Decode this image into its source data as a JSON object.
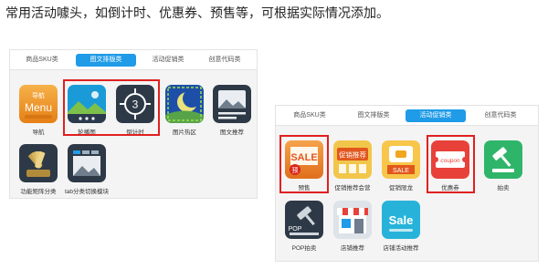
{
  "heading": "常用活动噱头，如倒计时、优惠券、预售等，可根据实际情况添加。",
  "left_panel": {
    "tabs": [
      "商品SKU类",
      "图文排版类",
      "活动促销类",
      "创意代码类"
    ],
    "active_tab": "图文排版类",
    "tiles": [
      {
        "label": "导航",
        "icon": "menu-icon",
        "icon_text": [
          "导航",
          "Menu"
        ]
      },
      {
        "label": "轮播图",
        "icon": "carousel-icon"
      },
      {
        "label": "倒计时",
        "icon": "countdown-icon",
        "icon_text": "3"
      },
      {
        "label": "图片热区",
        "icon": "hotspot-icon"
      },
      {
        "label": "图文推荐",
        "icon": "image-text-icon"
      },
      {
        "label": "功能矩阵分类",
        "icon": "matrix-icon"
      },
      {
        "label": "tab分类切换模块",
        "icon": "tab-switch-icon"
      }
    ]
  },
  "right_panel": {
    "tabs": [
      "商品SKU类",
      "图文排版类",
      "活动促销类",
      "创意代码类"
    ],
    "active_tab": "活动促销类",
    "tiles": [
      {
        "label": "预售",
        "icon": "presale-icon",
        "icon_text": [
          "SALE",
          "预"
        ]
      },
      {
        "label": "促销推荐会营",
        "icon": "promo-recommend-icon",
        "icon_text": "促销推荐"
      },
      {
        "label": "促销限龙",
        "icon": "limited-sale-icon",
        "icon_text": "SALE"
      },
      {
        "label": "优惠券",
        "icon": "coupon-icon",
        "icon_text": "coupon"
      },
      {
        "label": "拍卖",
        "icon": "auction-icon"
      },
      {
        "label": "POP拍卖",
        "icon": "pop-auction-icon",
        "icon_text": "POP"
      },
      {
        "label": "店铺推荐",
        "icon": "shop-recommend-icon"
      },
      {
        "label": "店铺活动推荐",
        "icon": "shop-activity-icon",
        "icon_text": "Sale"
      }
    ]
  },
  "colors": {
    "accent": "#1f9be7",
    "highlight": "#e02020"
  }
}
